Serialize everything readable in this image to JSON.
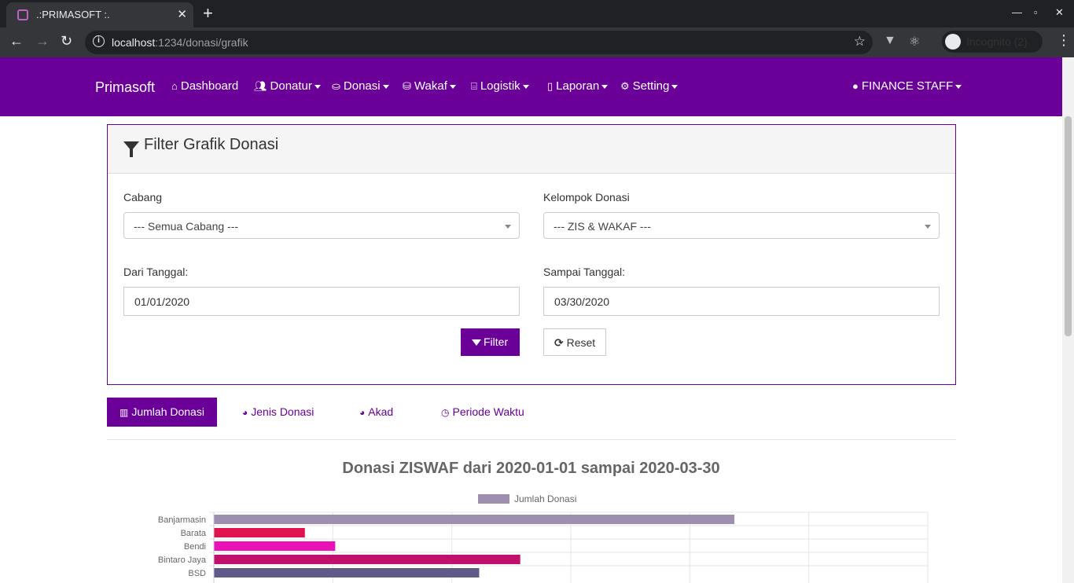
{
  "browser": {
    "tab_title": ".:PRIMASOFT :.",
    "url_host": "localhost",
    "url_path": ":1234/donasi/grafik",
    "incognito_label": "Incognito (2)"
  },
  "navbar": {
    "brand": "Primasoft",
    "items": [
      {
        "label": "Dashboard",
        "icon": "home-icon",
        "dropdown": false
      },
      {
        "label": "Donatur",
        "icon": "users-icon",
        "dropdown": true
      },
      {
        "label": "Donasi",
        "icon": "hand-donate-icon",
        "dropdown": true
      },
      {
        "label": "Wakaf",
        "icon": "hand-holding-icon",
        "dropdown": true
      },
      {
        "label": "Logistik",
        "icon": "warehouse-icon",
        "dropdown": true
      },
      {
        "label": "Laporan",
        "icon": "file-icon",
        "dropdown": true
      },
      {
        "label": "Setting",
        "icon": "cogs-icon",
        "dropdown": true
      }
    ],
    "user": "FINANCE STAFF"
  },
  "filter": {
    "title": "Filter Grafik Donasi",
    "cabang_label": "Cabang",
    "cabang_value": "--- Semua Cabang ---",
    "kelompok_label": "Kelompok Donasi",
    "kelompok_value": "--- ZIS & WAKAF ---",
    "dari_label": "Dari Tanggal:",
    "dari_value": "01/01/2020",
    "sampai_label": "Sampai Tanggal:",
    "sampai_value": "03/30/2020",
    "filter_button": "Filter",
    "reset_button": "Reset"
  },
  "tabs": [
    {
      "label": "Jumlah Donasi",
      "active": true
    },
    {
      "label": "Jenis Donasi",
      "active": false
    },
    {
      "label": "Akad",
      "active": false
    },
    {
      "label": "Periode Waktu",
      "active": false
    }
  ],
  "colors": {
    "brand": "#6a0097"
  },
  "chart_data": {
    "type": "bar",
    "orientation": "horizontal",
    "title": "Donasi ZISWAF dari 2020-01-01 sampai 2020-03-30",
    "legend": "Jumlah Donasi",
    "legend_position": "top",
    "grid": true,
    "categories": [
      "Banjarmasin",
      "Barata",
      "Bendi",
      "Bintaro Jaya",
      "BSD"
    ],
    "values": [
      875,
      153,
      204,
      515,
      446
    ],
    "colors": [
      "#9e8faf",
      "#e0124f",
      "#e812b8",
      "#c0106b",
      "#5e5a8a"
    ],
    "xlim": [
      0,
      1200
    ]
  }
}
